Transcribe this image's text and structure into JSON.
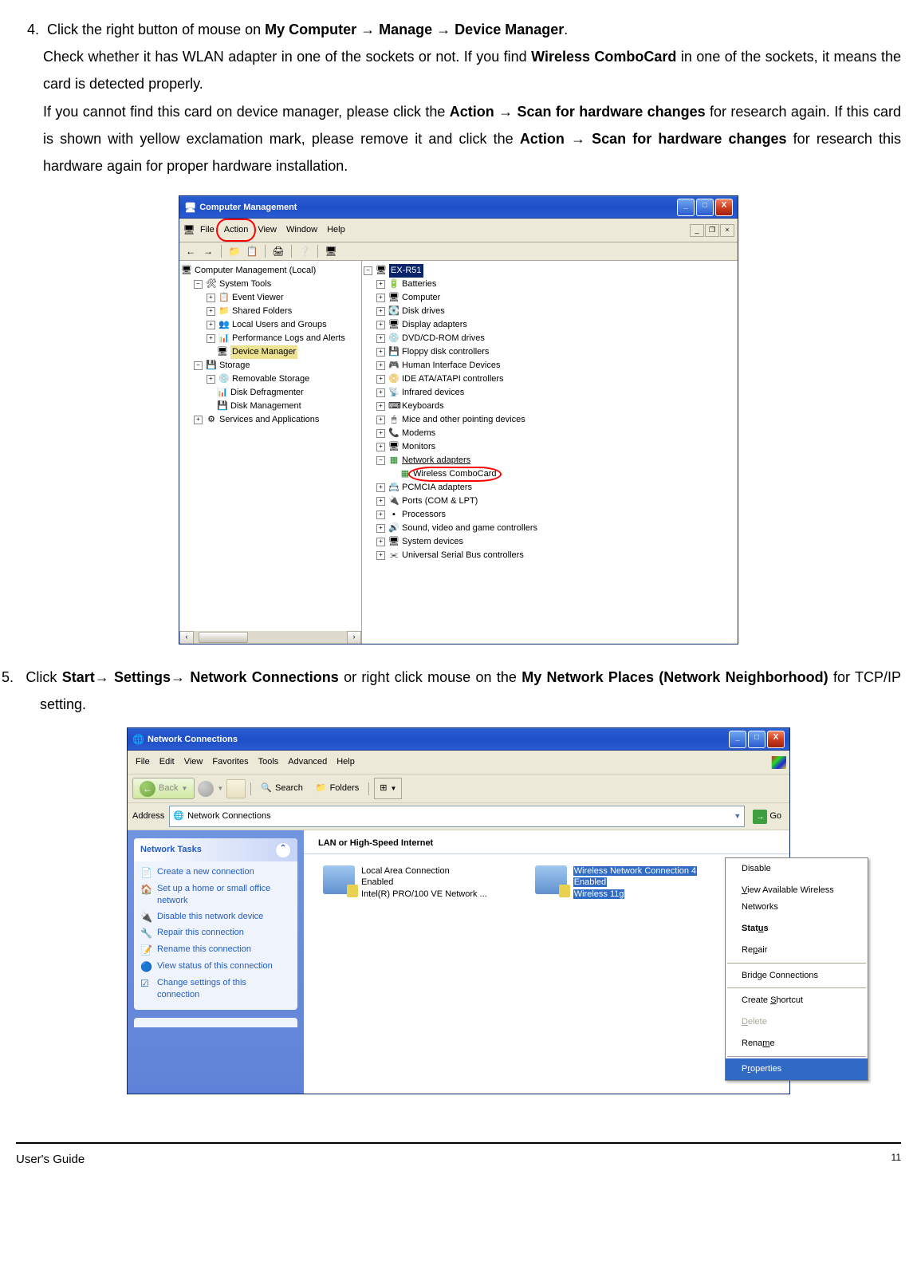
{
  "instruction4": {
    "num": "4.",
    "line1_a": " Click the right button of mouse on ",
    "line1_b": "My Computer → Manage → Device Manager",
    "line1_c": ".",
    "line2_a": "Check whether it has WLAN adapter in one of the sockets or not.  If you find ",
    "line2_b": "Wireless ComboCard",
    "line2_c": " in one of the sockets, it means the card is detected properly.",
    "line3_a": "If you cannot find this card on device manager, please click the ",
    "line3_b": "Action → Scan for hardware changes",
    "line3_c": " for research again. If this card is shown with yellow exclamation mark, please remove it and click the ",
    "line3_d": "Action → Scan for hardware changes",
    "line3_e": " for research this hardware again for proper hardware installation."
  },
  "cm": {
    "title": "Computer Management",
    "menu": [
      "File",
      "Action",
      "View",
      "Window",
      "Help"
    ],
    "left_root": "Computer Management (Local)",
    "system_tools": "System Tools",
    "st_items": [
      "Event Viewer",
      "Shared Folders",
      "Local Users and Groups",
      "Performance Logs and Alerts",
      "Device Manager"
    ],
    "storage": "Storage",
    "storage_items": [
      "Removable Storage",
      "Disk Defragmenter",
      "Disk Management"
    ],
    "services": "Services and Applications",
    "right_root": "EX-R51",
    "right_items": [
      "Batteries",
      "Computer",
      "Disk drives",
      "Display adapters",
      "DVD/CD-ROM drives",
      "Floppy disk controllers",
      "Human Interface Devices",
      "IDE ATA/ATAPI controllers",
      "Infrared devices",
      "Keyboards",
      "Mice and other pointing devices",
      "Modems",
      "Monitors",
      "Network adapters"
    ],
    "wireless": "Wireless  ComboCard",
    "right_items2": [
      "PCMCIA adapters",
      "Ports (COM & LPT)",
      "Processors",
      "Sound, video and game controllers",
      "System devices",
      "Universal Serial Bus controllers"
    ]
  },
  "instruction5": {
    "num": "5.",
    "a": " Click ",
    "b": "Start→ Settings→ Network Connections",
    "c": " or right click mouse on the ",
    "d": "My Network Places (Network Neighborhood)",
    "e": " for TCP/IP setting."
  },
  "nc": {
    "title": "Network Connections",
    "menu": [
      "File",
      "Edit",
      "View",
      "Favorites",
      "Tools",
      "Advanced",
      "Help"
    ],
    "back": "Back",
    "search": "Search",
    "folders": "Folders",
    "address_label": "Address",
    "address_value": "Network Connections",
    "go": "Go",
    "tasks_header": "Network Tasks",
    "tasks": [
      "Create a new connection",
      "Set up a home or small office network",
      "Disable this network device",
      "Repair this connection",
      "Rename this connection",
      "View status of this connection",
      "Change settings of this connection"
    ],
    "section": "LAN or High-Speed Internet",
    "lan": {
      "name": "Local Area Connection",
      "status": "Enabled",
      "device": "Intel(R) PRO/100 VE Network ..."
    },
    "wlan": {
      "name": "Wireless Network Connection 4",
      "status": "Enabled",
      "device": "Wireless 11g"
    },
    "context": [
      "Disable",
      "View Available Wireless Networks",
      "Status",
      "Repair",
      "Bridge Connections",
      "Create Shortcut",
      "Delete",
      "Rename",
      "Properties"
    ]
  },
  "footer": {
    "left": "User's Guide",
    "right": "11"
  }
}
